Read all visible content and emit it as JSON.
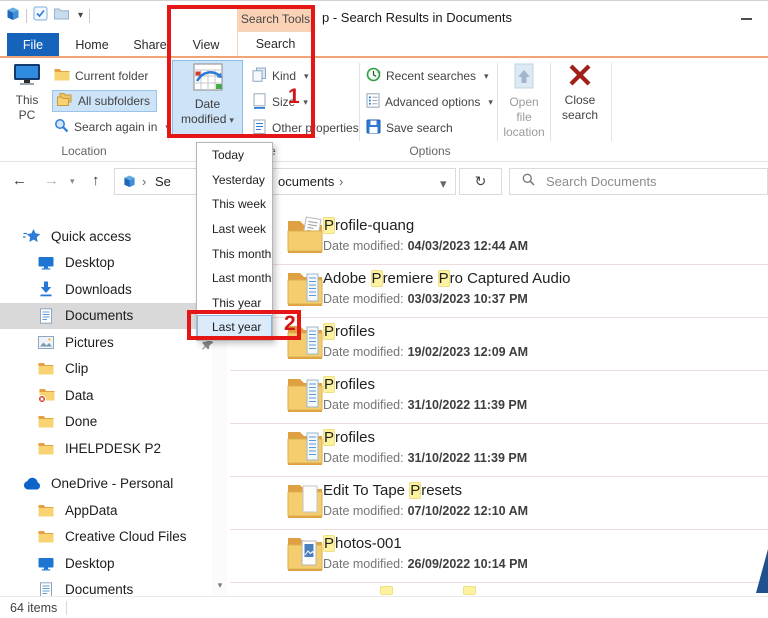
{
  "window": {
    "title": "p - Search Results in Documents"
  },
  "icons": {
    "caret": "▾",
    "back": "←",
    "forward": "→",
    "up": "↑",
    "refresh": "↻",
    "breadcrumb_sep": "›",
    "scroll_down": "▾"
  },
  "tabs": {
    "file": "File",
    "home": "Home",
    "share": "Share",
    "view": "View",
    "search": "Search",
    "contextual": "Search Tools"
  },
  "ribbon": {
    "location": {
      "label": "Location",
      "this_pc_line1": "This",
      "this_pc_line2": "PC",
      "current_folder": "Current folder",
      "all_subfolders": "All subfolders",
      "search_again": "Search again in"
    },
    "refine": {
      "label": "Refine",
      "date_modified_line1": "Date",
      "date_modified_line2": "modified",
      "kind": "Kind",
      "size": "Size",
      "other_properties": "Other properties"
    },
    "options": {
      "label": "Options",
      "recent_searches": "Recent searches",
      "advanced_options": "Advanced options",
      "save_search": "Save search",
      "open_file_line1": "Open file",
      "open_file_line2": "location",
      "close_line1": "Close",
      "close_line2": "search"
    }
  },
  "annotations": {
    "step1": "1",
    "step2": "2"
  },
  "address_bar": {
    "breadcrumb_prefix": "Se",
    "breadcrumb_suffix": "ocuments",
    "search_placeholder": "Search Documents"
  },
  "dropdown": {
    "items": [
      "Today",
      "Yesterday",
      "This week",
      "Last week",
      "This month",
      "Last month",
      "This year",
      "Last year"
    ],
    "highlighted": "Last year"
  },
  "sidebar": {
    "items": [
      {
        "label": "Quick access",
        "icon": "star",
        "level": 0
      },
      {
        "label": "Desktop",
        "icon": "monitor",
        "level": 1
      },
      {
        "label": "Downloads",
        "icon": "download",
        "level": 1
      },
      {
        "label": "Documents",
        "icon": "doc",
        "level": 1,
        "selected": true
      },
      {
        "label": "Pictures",
        "icon": "image",
        "level": 1,
        "pinned": true
      },
      {
        "label": "Clip",
        "icon": "folder",
        "level": 1
      },
      {
        "label": "Data",
        "icon": "folderError",
        "level": 1
      },
      {
        "label": "Done",
        "icon": "folder",
        "level": 1
      },
      {
        "label": "IHELPDESK P2",
        "icon": "folder",
        "level": 1
      },
      {
        "label": "OneDrive - Personal",
        "icon": "cloud",
        "level": 0,
        "gap": true
      },
      {
        "label": "AppData",
        "icon": "folder",
        "level": 1
      },
      {
        "label": "Creative Cloud Files",
        "icon": "folder",
        "level": 1
      },
      {
        "label": "Desktop",
        "icon": "monitor",
        "level": 1
      },
      {
        "label": "Documents",
        "icon": "doc",
        "level": 1
      }
    ]
  },
  "results_date_label": "Date modified:",
  "results": [
    {
      "icon": "folderDoc",
      "segments": [
        [
          "P",
          1
        ],
        [
          "rofile-quang",
          0
        ]
      ],
      "date": "04/03/2023 12:44 AM"
    },
    {
      "icon": "folderBlue",
      "segments": [
        [
          "Adobe ",
          0
        ],
        [
          "P",
          1
        ],
        [
          "remiere ",
          0
        ],
        [
          "P",
          1
        ],
        [
          "ro Captured Audio",
          0
        ]
      ],
      "date": "03/03/2023 10:37 PM"
    },
    {
      "icon": "folderBlue",
      "segments": [
        [
          "P",
          1
        ],
        [
          "rofiles",
          0
        ]
      ],
      "date": "19/02/2023 12:09 AM"
    },
    {
      "icon": "folderBlue",
      "segments": [
        [
          "P",
          1
        ],
        [
          "rofiles",
          0
        ]
      ],
      "date": "31/10/2022 11:39 PM"
    },
    {
      "icon": "folderBlue",
      "segments": [
        [
          "P",
          1
        ],
        [
          "rofiles",
          0
        ]
      ],
      "date": "31/10/2022 11:39 PM"
    },
    {
      "icon": "folderPage",
      "segments": [
        [
          "Edit To Tape ",
          0
        ],
        [
          "P",
          1
        ],
        [
          "resets",
          0
        ]
      ],
      "date": "07/10/2022 12:10 AM"
    },
    {
      "icon": "folderPhoto",
      "segments": [
        [
          "P",
          1
        ],
        [
          "hotos-001",
          0
        ]
      ],
      "date": "26/09/2022 10:14 PM"
    }
  ],
  "status": {
    "items_count": "64 items"
  },
  "colors": {
    "annotation_red": "#e51616",
    "highlight_yellow": "#fcf2a0",
    "accent_blue": "#1c6fc4",
    "file_tab_blue": "#1663bc",
    "contextual_tab_peach": "#fbd2b5",
    "ribbon_button_highlight": "#cde3f7",
    "sidebar_selected_gray": "#d9d9d9",
    "close_search_red": "#a02018"
  }
}
